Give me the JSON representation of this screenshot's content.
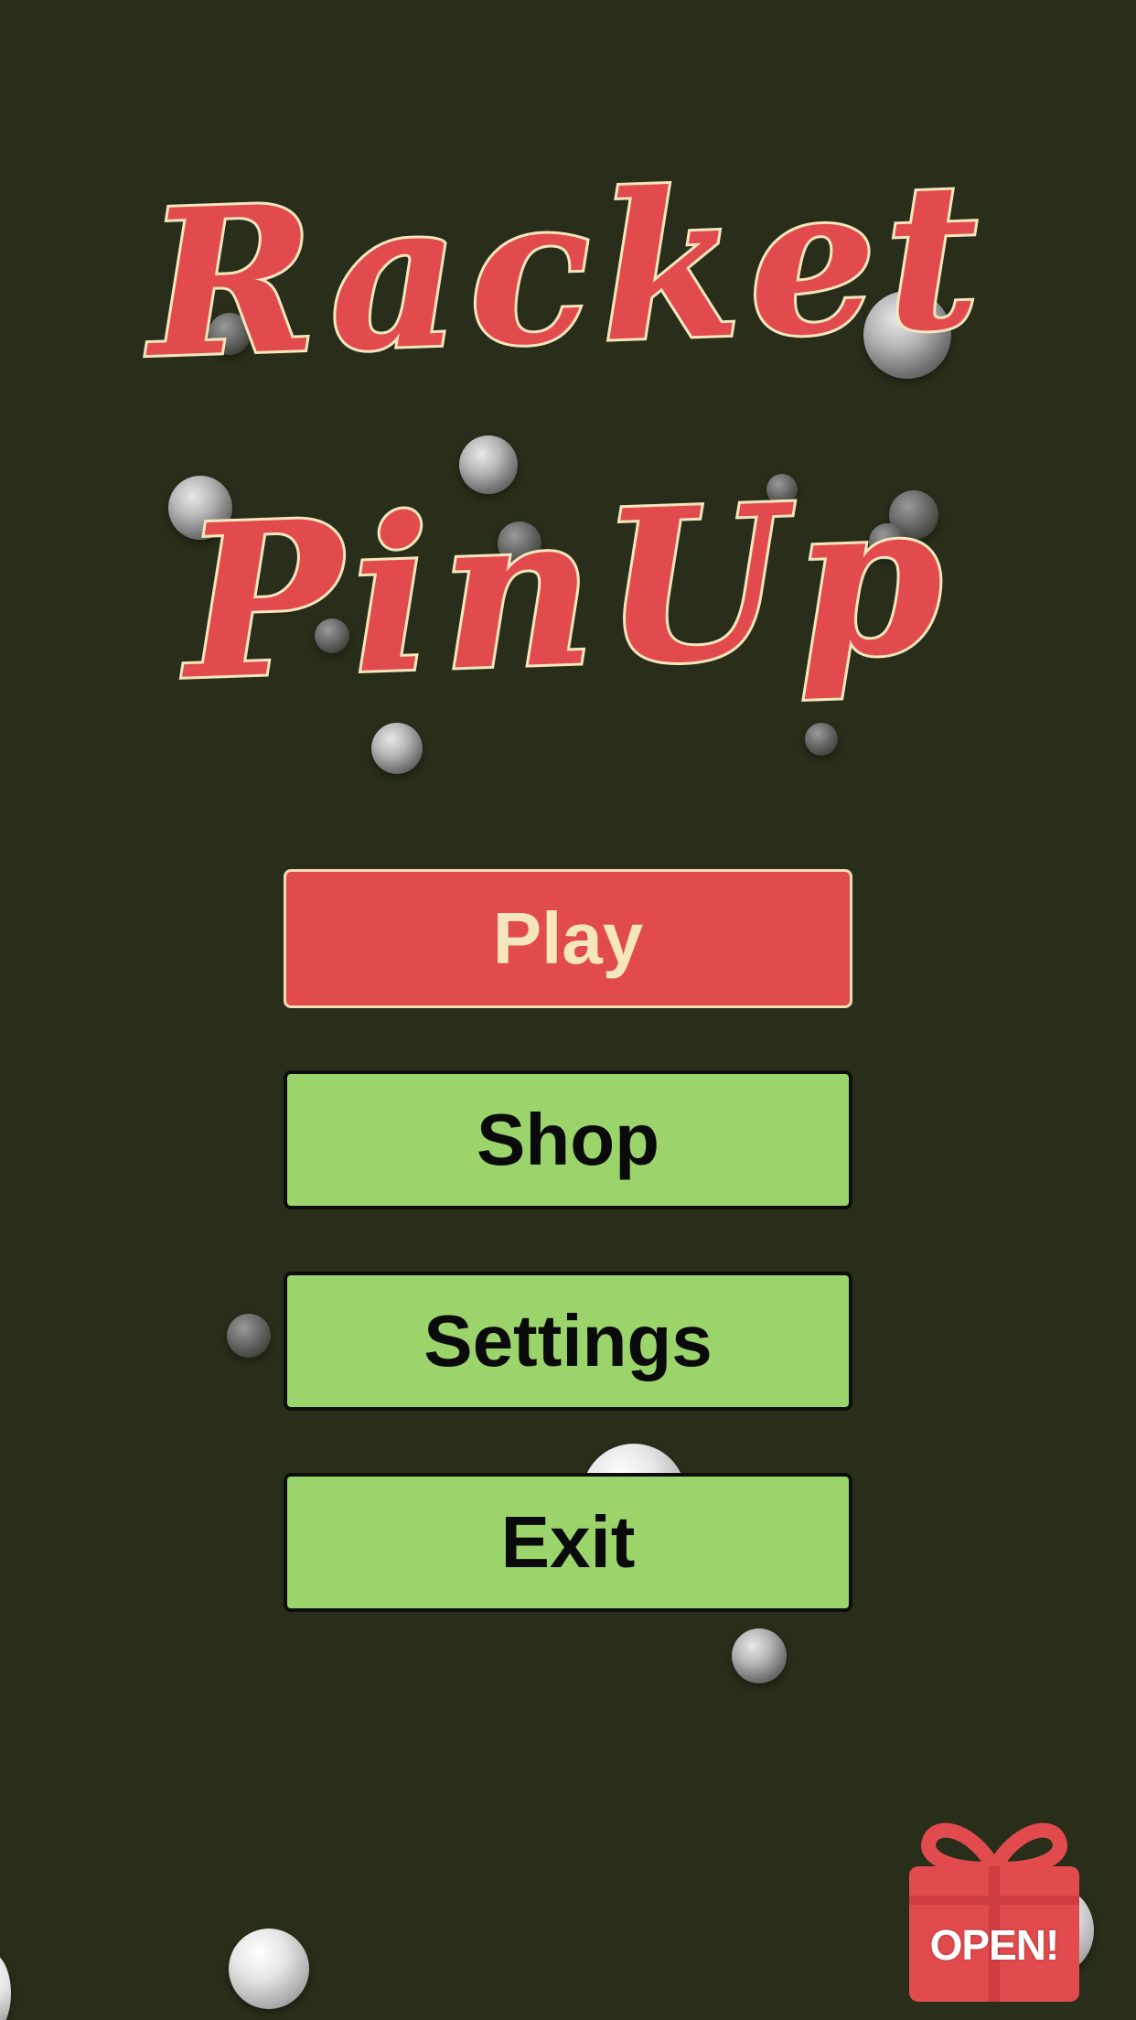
{
  "title": {
    "line1": "Racket",
    "line2": "PinUp"
  },
  "menu": {
    "play_label": "Play",
    "shop_label": "Shop",
    "settings_label": "Settings",
    "exit_label": "Exit"
  },
  "gift": {
    "label": "OPEN!",
    "icon": "gift-icon"
  },
  "colors": {
    "background": "#282e19",
    "title_fill": "#e24b4d",
    "title_outline": "#f6e7be",
    "play_button": "#e24b4b",
    "menu_button": "#9cd46c",
    "gift": "#e24b4d"
  }
}
